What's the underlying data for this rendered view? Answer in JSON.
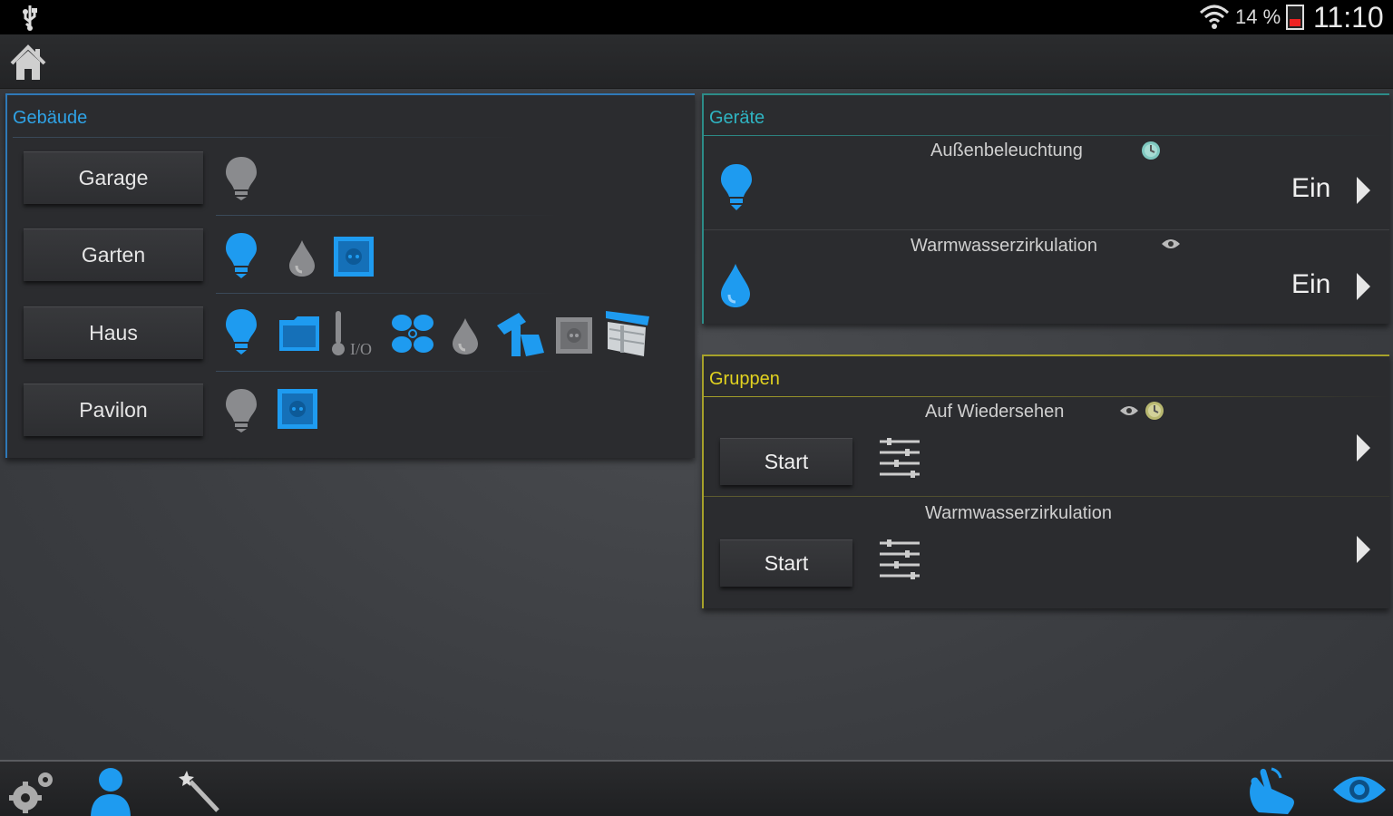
{
  "status_bar": {
    "battery_percent": "14 %",
    "time": "11:10",
    "icons": [
      "usb-icon",
      "wifi-icon",
      "battery-icon"
    ]
  },
  "action_bar": {
    "icons": [
      "home-icon"
    ]
  },
  "buildings": {
    "title": "Gebäude",
    "items": [
      {
        "label": "Garage",
        "icons": [
          "bulb-off-icon"
        ]
      },
      {
        "label": "Garten",
        "icons": [
          "bulb-on-icon",
          "water-drop-off-icon",
          "socket-on-icon"
        ]
      },
      {
        "label": "Haus",
        "icons": [
          "bulb-on-icon",
          "blind-icon",
          "thermometer-icon",
          "fan-icon",
          "water-drop-off-icon",
          "tap-icon",
          "socket-off-icon",
          "shutter-icon"
        ]
      },
      {
        "label": "Pavilon",
        "icons": [
          "bulb-off-icon",
          "socket-on-icon"
        ]
      }
    ],
    "thermometer_label": "I/O"
  },
  "devices": {
    "title": "Geräte",
    "items": [
      {
        "name": "Außenbeleuchtung",
        "state": "Ein",
        "icon": "bulb-on-icon",
        "badges": [
          "clock-icon"
        ]
      },
      {
        "name": "Warmwasserzirkulation",
        "state": "Ein",
        "icon": "water-drop-on-icon",
        "badges": [
          "eye-icon"
        ]
      }
    ]
  },
  "groups": {
    "title": "Gruppen",
    "items": [
      {
        "name": "Auf Wiedersehen",
        "button": "Start",
        "badges": [
          "eye-icon",
          "clock-icon"
        ]
      },
      {
        "name": "Warmwasserzirkulation",
        "button": "Start",
        "badges": []
      }
    ]
  },
  "bottom_bar": {
    "icons": [
      "settings-icon",
      "user-icon",
      "magic-wand-icon",
      "hand-icon",
      "eye-icon"
    ]
  },
  "colors": {
    "accent_blue": "#1e9bf0",
    "buildings_title": "#2fa3e6",
    "devices_title": "#2fb4c2",
    "groups_title": "#e2d320"
  }
}
